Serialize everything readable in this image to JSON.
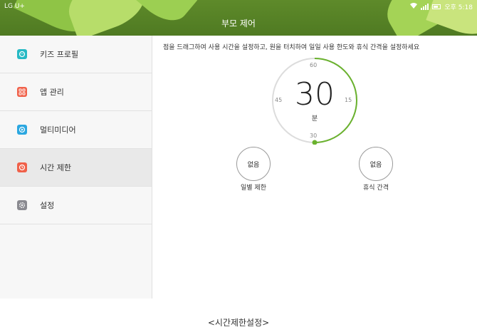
{
  "status": {
    "carrier": "LG U+",
    "time": "오후 5:18"
  },
  "header": {
    "title": "부모 제어"
  },
  "sidebar": {
    "items": [
      {
        "label": "키즈 프로필",
        "icon": "kids-profile-icon"
      },
      {
        "label": "앱 관리",
        "icon": "apps-grid-icon"
      },
      {
        "label": "멀티미디어",
        "icon": "multimedia-icon"
      },
      {
        "label": "시간 제한",
        "icon": "clock-icon",
        "active": true
      },
      {
        "label": "설정",
        "icon": "settings-icon"
      }
    ]
  },
  "main": {
    "instruction": "점을 드래그하여 사용 시간을 설정하고, 원을 터치하여 일일 사용 한도와 휴식 간격을 설정하세요",
    "dial": {
      "value": "30",
      "unit": "분",
      "ticks": {
        "top": "60",
        "right": "15",
        "bottom": "30",
        "left": "45"
      },
      "max_minutes": 60,
      "set_minutes": 30
    },
    "daily_limit": {
      "value": "없음",
      "label": "일별 제한"
    },
    "break_interval": {
      "value": "없음",
      "label": "휴식 간격"
    }
  },
  "caption": "<시간제한설정>",
  "colors": {
    "accent": "#6ab22e",
    "header": "#54802a"
  }
}
